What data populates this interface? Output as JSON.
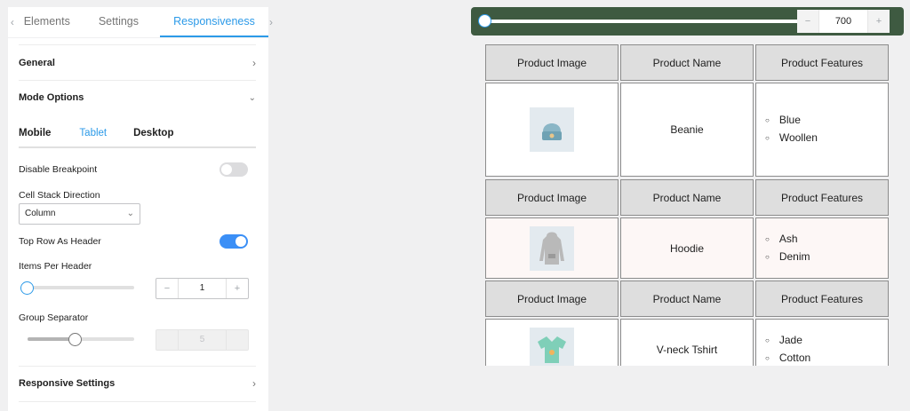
{
  "sidebar": {
    "tabs": [
      "Elements",
      "Settings",
      "Responsiveness"
    ],
    "active_tab": "Responsiveness",
    "sections": {
      "general": "General",
      "mode_options": "Mode Options",
      "responsive_settings": "Responsive Settings"
    },
    "modes": [
      "Mobile",
      "Tablet",
      "Desktop"
    ],
    "active_mode": "Tablet",
    "disable_breakpoint": {
      "label": "Disable Breakpoint",
      "enabled": false
    },
    "cell_stack_direction": {
      "label": "Cell Stack Direction",
      "value": "Column"
    },
    "top_row_as_header": {
      "label": "Top Row As Header",
      "enabled": true
    },
    "items_per_header": {
      "label": "Items Per Header",
      "value": "1",
      "slider_fraction": 0.0
    },
    "group_separator": {
      "label": "Group Separator",
      "value": "5",
      "slider_fraction": 0.45,
      "disabled": true
    },
    "stepper_minus": "−",
    "stepper_plus": "+"
  },
  "preview": {
    "width_value": "700",
    "width_slider_fraction": 0.0,
    "accent": "#3e5a41",
    "header": [
      "Product Image",
      "Product Name",
      "Product Features"
    ],
    "rows": [
      {
        "name": "Beanie",
        "features": [
          "Blue",
          "Woollen"
        ],
        "image_icon": "beanie-icon"
      },
      {
        "name": "Hoodie",
        "features": [
          "Ash",
          "Denim"
        ],
        "image_icon": "hoodie-icon"
      },
      {
        "name": "V-neck Tshirt",
        "features": [
          "Jade",
          "Cotton"
        ],
        "image_icon": "tshirt-icon"
      }
    ]
  }
}
